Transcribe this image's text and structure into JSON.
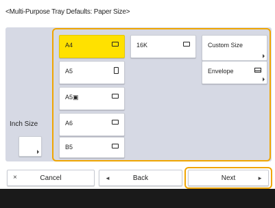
{
  "title": "<Multi-Purpose Tray Defaults: Paper Size>",
  "inch_size_label": "Inch Size",
  "sizes": [
    {
      "label": "A4",
      "icon": "landscape-sheet-icon",
      "selected": true
    },
    {
      "label": "A5",
      "icon": "portrait-sheet-icon",
      "selected": false
    },
    {
      "label": "A5▣",
      "icon": "landscape-sheet-icon",
      "selected": false
    },
    {
      "label": "A6",
      "icon": "landscape-sheet-icon",
      "selected": false
    },
    {
      "label": "B5",
      "icon": "landscape-sheet-icon",
      "selected": false
    },
    {
      "label": "16K",
      "icon": "landscape-sheet-icon",
      "selected": false
    }
  ],
  "custom_size_label": "Custom Size",
  "envelope_label": "Envelope",
  "buttons": {
    "cancel": "Cancel",
    "back": "Back",
    "next": "Next"
  },
  "icons": {
    "cancel": "×",
    "back": "◄",
    "next": "►"
  },
  "colors": {
    "selected": "#ffe100",
    "highlight_outline": "#f0a500",
    "panel": "#d6d9e4",
    "bottom_bar": "#1a1a1a"
  }
}
